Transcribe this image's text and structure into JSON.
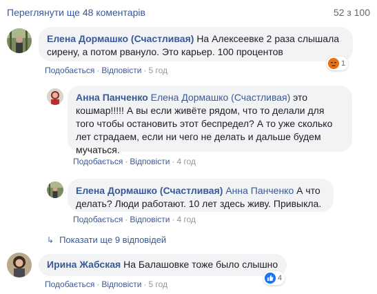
{
  "header": {
    "view_more": "Переглянути ще 48 коментарів",
    "counter": "52 з 100"
  },
  "comments": [
    {
      "author": "Елена Дормашко (Счастливая)",
      "text": "На Алексеевке 2 раза слышала сирену, а потом рвануло. Это карьер. 100 процентов",
      "like": "Подобається",
      "reply": "Відповісти",
      "time": "5 год",
      "reaction_count": "1",
      "reaction_icon": "angry-icon"
    },
    {
      "author": "Анна Панченко",
      "mention": "Елена Дормашко (Счастливая)",
      "text": "это кошмар!!!!! А вы если живёте рядом, что то делали для того чтобы остановить этот беспредел? А то уже сколько лет страдаем, если ни чего не делать и дальше будем мучаться.",
      "like": "Подобається",
      "reply": "Відповісти",
      "time": "4 год"
    },
    {
      "author": "Елена Дормашко (Счастливая)",
      "mention": "Анна Панченко",
      "text": "А что делать? Люди работают. 10 лет здесь живу. Привыкла.",
      "like": "Подобається",
      "reply": "Відповісти",
      "time": "4 год"
    },
    {
      "author": "Ирина Жабская",
      "text": "На Балашовке тоже было слышно",
      "like": "Подобається",
      "reply": "Відповісти",
      "time": "5 год",
      "reaction_count": "4",
      "reaction_icon": "like-icon"
    }
  ],
  "more_replies": "Показати ще 9 відповідей",
  "colors": {
    "link": "#385898",
    "bubble": "#f2f3f5",
    "meta": "#90949c",
    "angry": "#e9710f",
    "like": "#1877f2"
  }
}
